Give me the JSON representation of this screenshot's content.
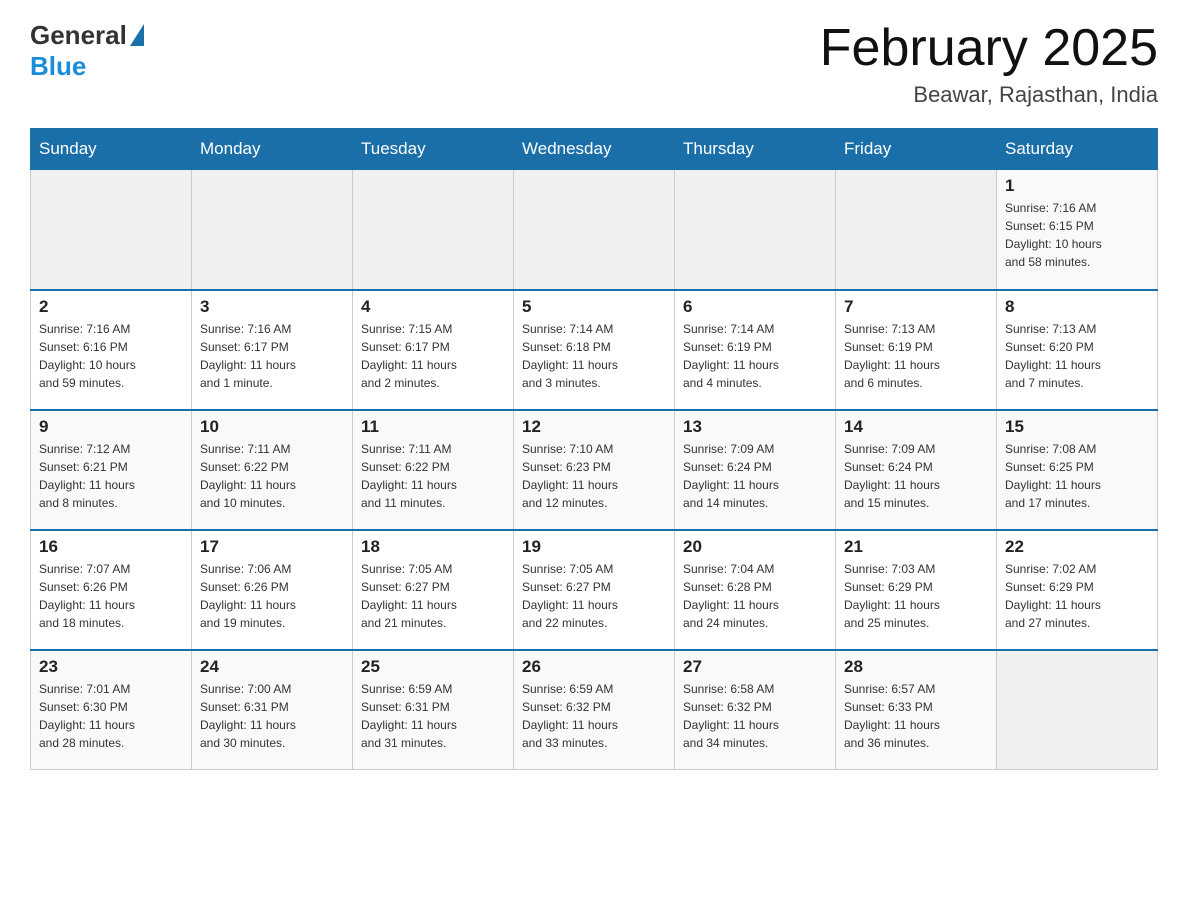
{
  "header": {
    "logo": {
      "general": "General",
      "blue": "Blue"
    },
    "title": "February 2025",
    "location": "Beawar, Rajasthan, India"
  },
  "weekdays": [
    "Sunday",
    "Monday",
    "Tuesday",
    "Wednesday",
    "Thursday",
    "Friday",
    "Saturday"
  ],
  "weeks": [
    [
      {
        "day": "",
        "info": ""
      },
      {
        "day": "",
        "info": ""
      },
      {
        "day": "",
        "info": ""
      },
      {
        "day": "",
        "info": ""
      },
      {
        "day": "",
        "info": ""
      },
      {
        "day": "",
        "info": ""
      },
      {
        "day": "1",
        "info": "Sunrise: 7:16 AM\nSunset: 6:15 PM\nDaylight: 10 hours\nand 58 minutes."
      }
    ],
    [
      {
        "day": "2",
        "info": "Sunrise: 7:16 AM\nSunset: 6:16 PM\nDaylight: 10 hours\nand 59 minutes."
      },
      {
        "day": "3",
        "info": "Sunrise: 7:16 AM\nSunset: 6:17 PM\nDaylight: 11 hours\nand 1 minute."
      },
      {
        "day": "4",
        "info": "Sunrise: 7:15 AM\nSunset: 6:17 PM\nDaylight: 11 hours\nand 2 minutes."
      },
      {
        "day": "5",
        "info": "Sunrise: 7:14 AM\nSunset: 6:18 PM\nDaylight: 11 hours\nand 3 minutes."
      },
      {
        "day": "6",
        "info": "Sunrise: 7:14 AM\nSunset: 6:19 PM\nDaylight: 11 hours\nand 4 minutes."
      },
      {
        "day": "7",
        "info": "Sunrise: 7:13 AM\nSunset: 6:19 PM\nDaylight: 11 hours\nand 6 minutes."
      },
      {
        "day": "8",
        "info": "Sunrise: 7:13 AM\nSunset: 6:20 PM\nDaylight: 11 hours\nand 7 minutes."
      }
    ],
    [
      {
        "day": "9",
        "info": "Sunrise: 7:12 AM\nSunset: 6:21 PM\nDaylight: 11 hours\nand 8 minutes."
      },
      {
        "day": "10",
        "info": "Sunrise: 7:11 AM\nSunset: 6:22 PM\nDaylight: 11 hours\nand 10 minutes."
      },
      {
        "day": "11",
        "info": "Sunrise: 7:11 AM\nSunset: 6:22 PM\nDaylight: 11 hours\nand 11 minutes."
      },
      {
        "day": "12",
        "info": "Sunrise: 7:10 AM\nSunset: 6:23 PM\nDaylight: 11 hours\nand 12 minutes."
      },
      {
        "day": "13",
        "info": "Sunrise: 7:09 AM\nSunset: 6:24 PM\nDaylight: 11 hours\nand 14 minutes."
      },
      {
        "day": "14",
        "info": "Sunrise: 7:09 AM\nSunset: 6:24 PM\nDaylight: 11 hours\nand 15 minutes."
      },
      {
        "day": "15",
        "info": "Sunrise: 7:08 AM\nSunset: 6:25 PM\nDaylight: 11 hours\nand 17 minutes."
      }
    ],
    [
      {
        "day": "16",
        "info": "Sunrise: 7:07 AM\nSunset: 6:26 PM\nDaylight: 11 hours\nand 18 minutes."
      },
      {
        "day": "17",
        "info": "Sunrise: 7:06 AM\nSunset: 6:26 PM\nDaylight: 11 hours\nand 19 minutes."
      },
      {
        "day": "18",
        "info": "Sunrise: 7:05 AM\nSunset: 6:27 PM\nDaylight: 11 hours\nand 21 minutes."
      },
      {
        "day": "19",
        "info": "Sunrise: 7:05 AM\nSunset: 6:27 PM\nDaylight: 11 hours\nand 22 minutes."
      },
      {
        "day": "20",
        "info": "Sunrise: 7:04 AM\nSunset: 6:28 PM\nDaylight: 11 hours\nand 24 minutes."
      },
      {
        "day": "21",
        "info": "Sunrise: 7:03 AM\nSunset: 6:29 PM\nDaylight: 11 hours\nand 25 minutes."
      },
      {
        "day": "22",
        "info": "Sunrise: 7:02 AM\nSunset: 6:29 PM\nDaylight: 11 hours\nand 27 minutes."
      }
    ],
    [
      {
        "day": "23",
        "info": "Sunrise: 7:01 AM\nSunset: 6:30 PM\nDaylight: 11 hours\nand 28 minutes."
      },
      {
        "day": "24",
        "info": "Sunrise: 7:00 AM\nSunset: 6:31 PM\nDaylight: 11 hours\nand 30 minutes."
      },
      {
        "day": "25",
        "info": "Sunrise: 6:59 AM\nSunset: 6:31 PM\nDaylight: 11 hours\nand 31 minutes."
      },
      {
        "day": "26",
        "info": "Sunrise: 6:59 AM\nSunset: 6:32 PM\nDaylight: 11 hours\nand 33 minutes."
      },
      {
        "day": "27",
        "info": "Sunrise: 6:58 AM\nSunset: 6:32 PM\nDaylight: 11 hours\nand 34 minutes."
      },
      {
        "day": "28",
        "info": "Sunrise: 6:57 AM\nSunset: 6:33 PM\nDaylight: 11 hours\nand 36 minutes."
      },
      {
        "day": "",
        "info": ""
      }
    ]
  ]
}
